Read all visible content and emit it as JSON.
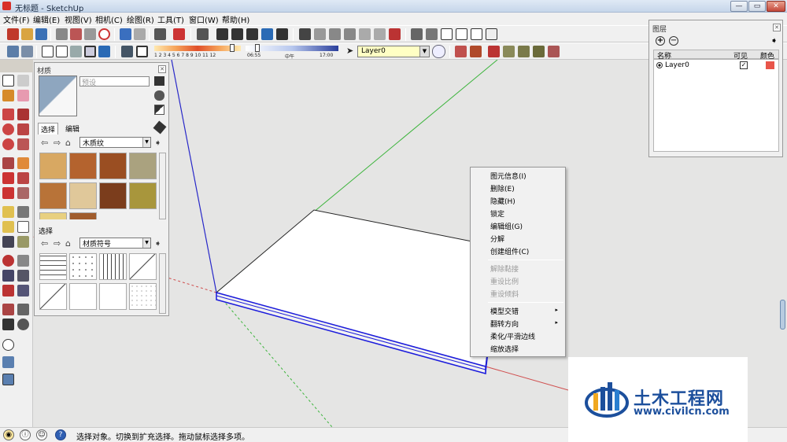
{
  "window": {
    "title": "无标题 - SketchUp",
    "min_label": "—",
    "max_label": "▭",
    "close_label": "✕"
  },
  "menubar": [
    "文件(F)",
    "编辑(E)",
    "视图(V)",
    "相机(C)",
    "绘图(R)",
    "工具(T)",
    "窗口(W)",
    "帮助(H)"
  ],
  "shadow_slider": {
    "ticks": "1  2  3  4  5  6  7  8  9  10 11 12"
  },
  "fog_slider": {
    "start": "06:55",
    "mid": "中午",
    "end": "17:00"
  },
  "layer_select": {
    "value": "Layer0"
  },
  "materials": {
    "title": "材质",
    "name_placeholder": "预设",
    "tabs": [
      "选择",
      "编辑"
    ],
    "collection": "木质纹",
    "section2_label": "选择",
    "collection2": "材质符号"
  },
  "layers_panel": {
    "title": "图层",
    "col_name": "名称",
    "col_visible": "可见",
    "col_color": "颜色",
    "rows": [
      {
        "name": "Layer0",
        "visible": true,
        "color": "#e8554a"
      }
    ]
  },
  "context_menu": {
    "items": [
      {
        "label": "图元信息(I)",
        "enabled": true
      },
      {
        "label": "删除(E)",
        "enabled": true
      },
      {
        "label": "隐藏(H)",
        "enabled": true
      },
      {
        "label": "锁定",
        "enabled": true
      },
      {
        "label": "编辑组(G)",
        "enabled": true
      },
      {
        "label": "分解",
        "enabled": true
      },
      {
        "label": "创建组件(C)",
        "enabled": true
      },
      {
        "label": "解除黏接",
        "enabled": false
      },
      {
        "label": "重设比例",
        "enabled": false
      },
      {
        "label": "重设倾斜",
        "enabled": false
      },
      {
        "label": "模型交错",
        "enabled": true,
        "submenu": true
      },
      {
        "label": "翻转方向",
        "enabled": true,
        "submenu": true
      },
      {
        "label": "柔化/平滑边线",
        "enabled": true
      },
      {
        "label": "缩放选择",
        "enabled": true
      }
    ]
  },
  "status": {
    "text": "选择对象。切换到扩充选择。拖动鼠标选择多项。"
  },
  "watermark": {
    "main": "土木工程网",
    "sub": "www.civilcn.com"
  }
}
